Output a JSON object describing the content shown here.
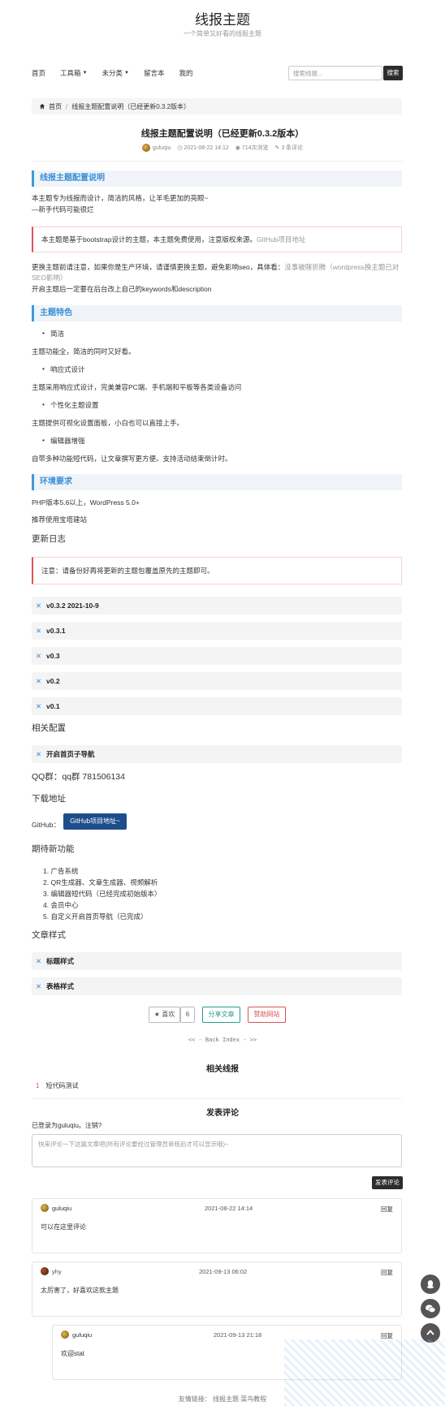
{
  "site": {
    "title": "线报主题",
    "subtitle": "一个简单又好看的线报主题"
  },
  "nav": {
    "items": [
      {
        "label": "首页",
        "has_caret": false
      },
      {
        "label": "工具箱",
        "has_caret": true
      },
      {
        "label": "未分类",
        "has_caret": true
      },
      {
        "label": "留言本",
        "has_caret": false
      },
      {
        "label": "我的",
        "has_caret": false
      }
    ],
    "search_placeholder": "搜索线报...",
    "search_button": "搜索"
  },
  "breadcrumb": {
    "home": "首页",
    "separator": "/",
    "current": "线报主题配置说明（已经更新0.3.2版本）"
  },
  "post": {
    "title": "线报主题配置说明（已经更新0.3.2版本）",
    "author": "guluqiu",
    "date": "2021-08-22 14:12",
    "views": "714次浏览",
    "comments": "3 条评论"
  },
  "content": {
    "h_config": "线报主题配置说明",
    "intro1": "本主题专为线报而设计，简洁的风格，让羊毛更加的亮眼~",
    "intro2": "—新手代码可能很烂",
    "notice1_text": "本主题是基于bootstrap设计的主题，本主题免费使用，注意版权来源。",
    "notice1_link": "GitHub项目地址",
    "warn_prefix": "更换主题前请注意，如果你是生产环境，请谨慎更换主题，避免影响seo，具体看：",
    "warn_link": "没事被瞎折腾（wordpress换主题已对SEO影响）",
    "note_after": "开启主题后一定要在后台改上自己的keywords和description",
    "h_features": "主题特色",
    "feat1": "简洁",
    "feat1_desc": "主题功能全，简洁的同时又好看。",
    "feat2": "响应式设计",
    "feat2_desc": "主题采用响应式设计，完美兼容PC端、手机端和平板等各类设备访问",
    "feat3": "个性化主题设置",
    "feat3_desc": "主题提供可视化设置面板，小白也可以直接上手。",
    "feat4": "编辑器增强",
    "feat4_desc": "自带多种功能短代码，让文章撰写更方便。支持活动结束倒计时。",
    "h_env": "环境要求",
    "env1": "PHP版本5.6以上，WordPress 5.0+",
    "env2": "推荐使用宝塔建站",
    "h_changelog": "更新日志",
    "notice2": "注意：请备份好再将更新的主题包覆盖原先的主题即可。",
    "versions": [
      "v0.3.2 2021-10-9",
      "v0.3.1",
      "v0.3",
      "v0.2",
      "v0.1"
    ],
    "h_related_config": "相关配置",
    "related_config_item": "开启首页子导航",
    "qq": "QQ群：qq群 781506134",
    "h_download": "下载地址",
    "github_label": "GitHub：",
    "github_button": "GitHub项目地址~",
    "h_expect": "期待新功能",
    "expect": [
      "广告系统",
      "QR生成器、文章生成器、视频解析",
      "编辑器短代码（已经完成初始版本）",
      "会员中心",
      "自定义开启首页导航（已完成）"
    ],
    "h_style": "文章样式",
    "style_items": [
      "标题样式",
      "表格样式"
    ]
  },
  "actions": {
    "like": "喜欢",
    "like_count": "6",
    "share": "分享文章",
    "donate": "赞助网站",
    "back": "<< - Back Index - >>"
  },
  "related": {
    "title": "相关线报",
    "items": [
      {
        "num": "1",
        "label": "短代码测试"
      }
    ]
  },
  "comment_form": {
    "title": "发表评论",
    "logged_in": "已登录为guluqiu。注销?",
    "placeholder": "快来评论一下这篇文章吧(所有评论要经过管理员审核后才可以显示哦)~",
    "submit": "发表评论"
  },
  "comments": [
    {
      "author": "guluqiu",
      "time": "2021-08-22 14:14",
      "reply": "回复",
      "text": "可以在这里评论"
    },
    {
      "author": "yhy",
      "time": "2021-09-13 06:02",
      "reply": "回复",
      "text": "太厉害了，好喜欢这款主题"
    },
    {
      "author": "guluqiu",
      "time": "2021-09-13 21:18",
      "reply": "回复",
      "text": "欢迎stat"
    }
  ],
  "footer": {
    "label": "友情链接：",
    "links": [
      "线报主题",
      "菜鸟教程"
    ]
  },
  "colors": {
    "accent": "#3b8fd6",
    "dark": "#2c2c2c",
    "danger": "#e05252",
    "teal": "#2a9d8f",
    "github": "#1e4d8c"
  }
}
